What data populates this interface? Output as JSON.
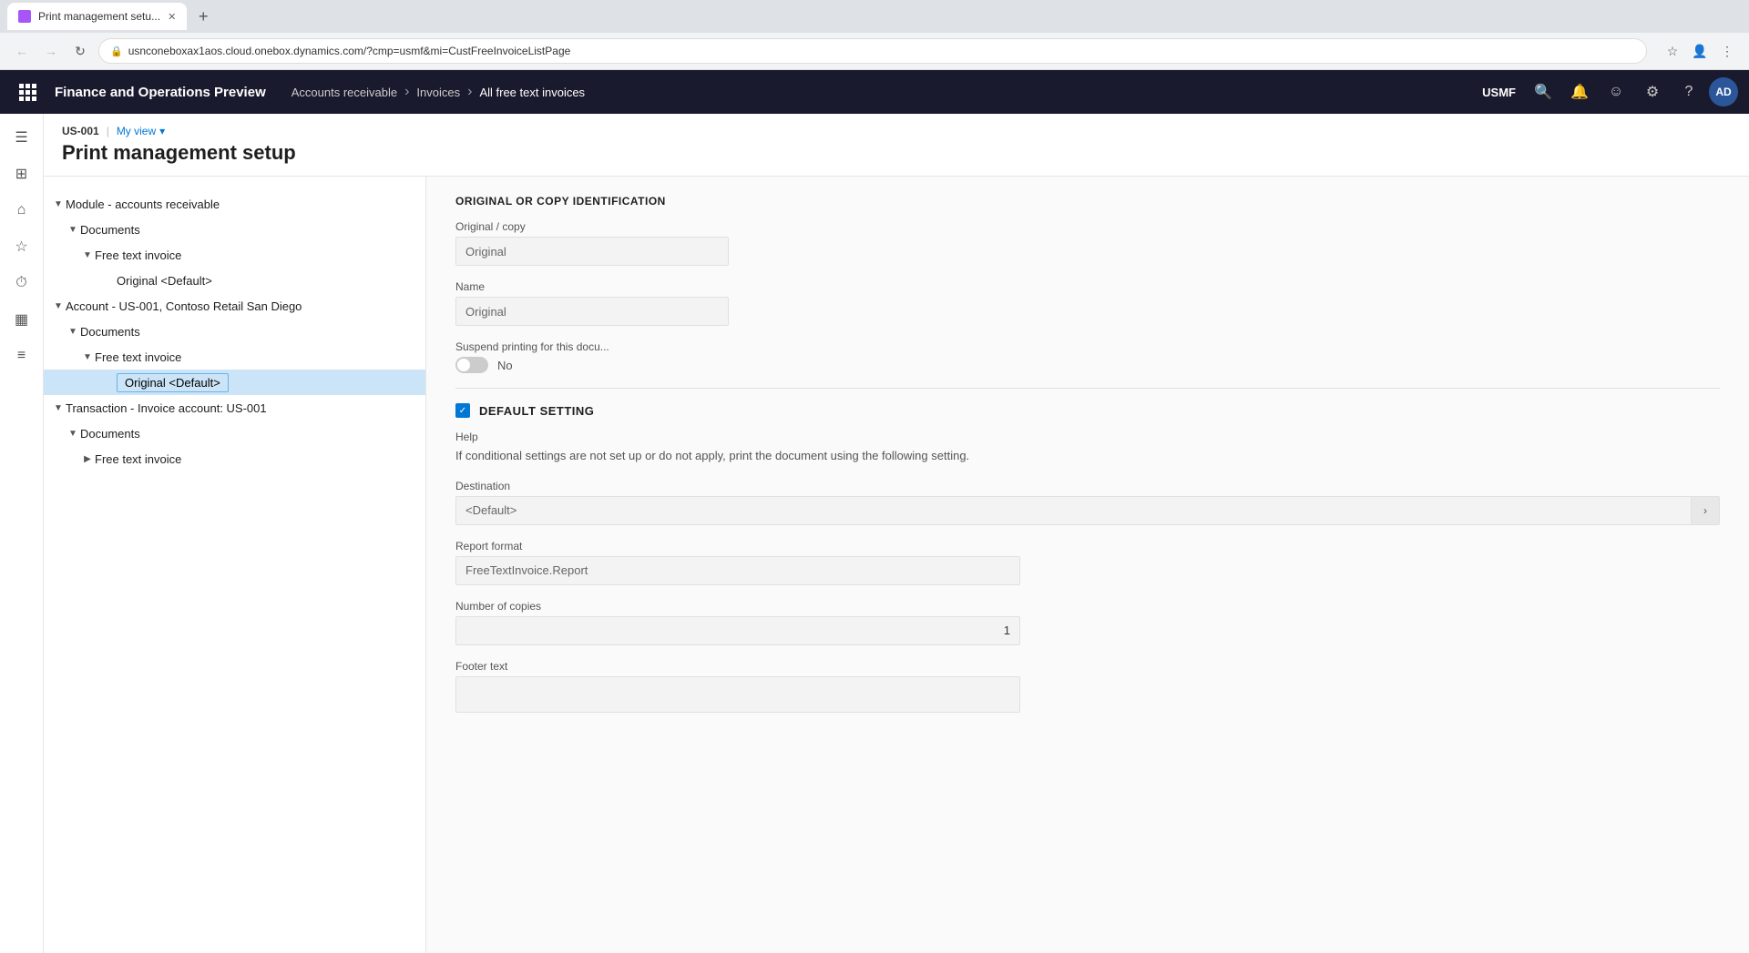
{
  "browser": {
    "tab_label": "Print management setu...",
    "tab_favicon": "purple",
    "url": "usnconeboxax1aos.cloud.onebox.dynamics.com/?cmp=usmf&mi=CustFreeInvoiceListPage",
    "new_tab_icon": "+",
    "back_disabled": false,
    "forward_disabled": false
  },
  "topnav": {
    "app_title": "Finance and Operations Preview",
    "breadcrumb": [
      {
        "label": "Accounts receivable",
        "is_current": false
      },
      {
        "label": "Invoices",
        "is_current": false
      },
      {
        "label": "All free text invoices",
        "is_current": true
      }
    ],
    "company": "USMF",
    "user_initials": "AD"
  },
  "page": {
    "company_code": "US-001",
    "view_label": "My view",
    "title": "Print management setup"
  },
  "tree": {
    "nodes": [
      {
        "id": "module",
        "label": "Module - accounts receivable",
        "indent": 0,
        "expanded": true,
        "arrow": "▼",
        "selected": false
      },
      {
        "id": "docs1",
        "label": "Documents",
        "indent": 1,
        "expanded": true,
        "arrow": "▼",
        "selected": false
      },
      {
        "id": "fti1",
        "label": "Free text invoice",
        "indent": 2,
        "expanded": true,
        "arrow": "▼",
        "selected": false
      },
      {
        "id": "orig1",
        "label": "Original <Default>",
        "indent": 3,
        "expanded": false,
        "arrow": "",
        "selected": false
      },
      {
        "id": "account",
        "label": "Account - US-001, Contoso Retail San Diego",
        "indent": 0,
        "expanded": true,
        "arrow": "▼",
        "selected": false
      },
      {
        "id": "docs2",
        "label": "Documents",
        "indent": 1,
        "expanded": true,
        "arrow": "▼",
        "selected": false
      },
      {
        "id": "fti2",
        "label": "Free text invoice",
        "indent": 2,
        "expanded": true,
        "arrow": "▼",
        "selected": false
      },
      {
        "id": "orig2",
        "label": "Original <Default>",
        "indent": 3,
        "expanded": false,
        "arrow": "",
        "selected": true
      },
      {
        "id": "transaction",
        "label": "Transaction - Invoice account: US-001",
        "indent": 0,
        "expanded": true,
        "arrow": "▼",
        "selected": false
      },
      {
        "id": "docs3",
        "label": "Documents",
        "indent": 1,
        "expanded": true,
        "arrow": "▼",
        "selected": false
      },
      {
        "id": "fti3",
        "label": "Free text invoice",
        "indent": 2,
        "expanded": false,
        "arrow": "▶",
        "selected": false
      }
    ]
  },
  "right_panel": {
    "section_title": "ORIGINAL OR COPY IDENTIFICATION",
    "original_copy_label": "Original / copy",
    "original_copy_value": "Original",
    "name_label": "Name",
    "name_value": "Original",
    "suspend_label": "Suspend printing for this docu...",
    "suspend_toggle": "off",
    "suspend_value": "No",
    "default_setting_label": "DEFAULT SETTING",
    "help_label": "Help",
    "help_text": "If conditional settings are not set up or do not apply, print the document using the following setting.",
    "destination_label": "Destination",
    "destination_value": "<Default>",
    "report_format_label": "Report format",
    "report_format_value": "FreeTextInvoice.Report",
    "num_copies_label": "Number of copies",
    "num_copies_value": "1",
    "footer_text_label": "Footer text",
    "footer_text_value": ""
  }
}
